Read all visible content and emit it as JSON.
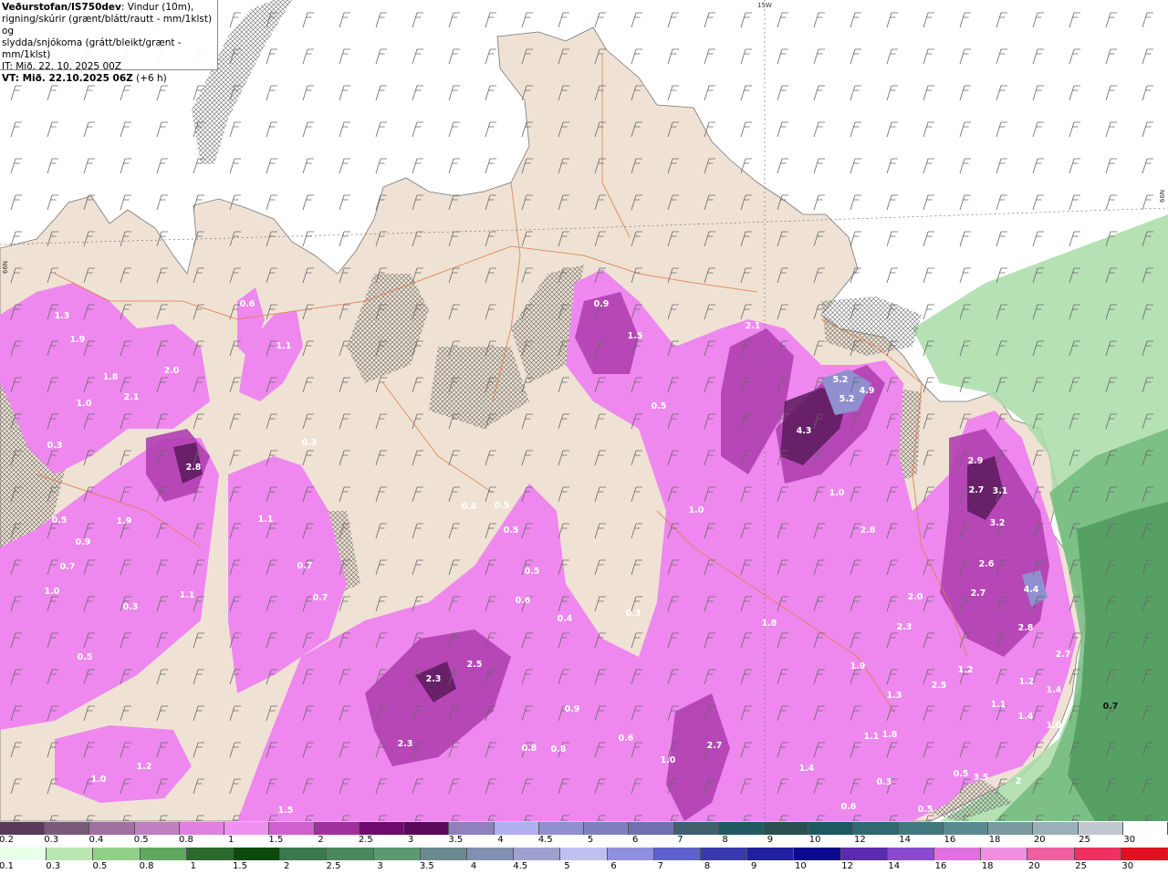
{
  "header": {
    "title_bold": "Veðurstofan/IS750dev",
    "title_rest": ": Vindur (10m),",
    "line2": "rigning/skúrir (grænt/blátt/rautt - mm/1klst) og",
    "line3": "slydda/snjókoma (grátt/bleikt/grænt - mm/1klst)",
    "line4": "IT: Mið. 22. 10. 2025 00Z",
    "line5_bold": "VT: Mið. 22.10.2025 06Z",
    "line5_rest": " (+6 h)"
  },
  "grid_labels": {
    "lon": "15W",
    "lat_right": "66N",
    "lat_left": "66N"
  },
  "colors": {
    "land": "#efe2d4",
    "sea": "#ffffff",
    "snow_light": "#ee88ee",
    "snow_mid": "#b040b0",
    "snow_dark": "#5a1a5a",
    "rain_light": "#a8dca8",
    "rain_mid": "#6fb87a",
    "rain_dark": "#3d8a4d",
    "road": "#e07a4a"
  },
  "map_labels": [
    {
      "text": "1.3"
    },
    {
      "text": "1.9"
    },
    {
      "text": "1.8"
    },
    {
      "text": "2.0"
    },
    {
      "text": "2.1"
    },
    {
      "text": "1.0"
    },
    {
      "text": "0.3"
    },
    {
      "text": "2.8"
    },
    {
      "text": "0.5"
    },
    {
      "text": "1.9"
    },
    {
      "text": "0.9"
    },
    {
      "text": "0.7"
    },
    {
      "text": "1.0"
    },
    {
      "text": "0.3"
    },
    {
      "text": "1.1"
    },
    {
      "text": "0.5"
    },
    {
      "text": "0.6"
    },
    {
      "text": "1.1"
    },
    {
      "text": "0.3"
    },
    {
      "text": "1.1"
    },
    {
      "text": "0.7"
    },
    {
      "text": "0.7"
    },
    {
      "text": "0.9"
    },
    {
      "text": "1.5"
    },
    {
      "text": "0.5"
    },
    {
      "text": "2.1"
    },
    {
      "text": "5.2"
    },
    {
      "text": "5.2"
    },
    {
      "text": "4.9"
    },
    {
      "text": "4.3"
    },
    {
      "text": "1.0"
    },
    {
      "text": "1.0"
    },
    {
      "text": "2.8"
    },
    {
      "text": "0.4"
    },
    {
      "text": "0.5"
    },
    {
      "text": "0.5"
    },
    {
      "text": "0.5"
    },
    {
      "text": "0.6"
    },
    {
      "text": "0.4"
    },
    {
      "text": "0.3"
    },
    {
      "text": "2.9"
    },
    {
      "text": "2.7"
    },
    {
      "text": "3.1"
    },
    {
      "text": "3.2"
    },
    {
      "text": "2.6"
    },
    {
      "text": "2.7"
    },
    {
      "text": "4.4"
    },
    {
      "text": "2.8"
    },
    {
      "text": "2.0"
    },
    {
      "text": "2.3"
    },
    {
      "text": "1.8"
    },
    {
      "text": "2.3"
    },
    {
      "text": "2.5"
    },
    {
      "text": "1.9"
    },
    {
      "text": "1.2"
    },
    {
      "text": "2.5"
    },
    {
      "text": "1.3"
    },
    {
      "text": "1.1"
    },
    {
      "text": "1.2"
    },
    {
      "text": "1.4"
    },
    {
      "text": "2.7"
    },
    {
      "text": "1.4"
    },
    {
      "text": "2.3"
    },
    {
      "text": "0.9"
    },
    {
      "text": "0.8"
    },
    {
      "text": "0.8"
    },
    {
      "text": "0.6"
    },
    {
      "text": "1.0"
    },
    {
      "text": "2.7"
    },
    {
      "text": "1.1"
    },
    {
      "text": "1.8"
    },
    {
      "text": "1.4"
    },
    {
      "text": "0.5"
    },
    {
      "text": "1.0"
    },
    {
      "text": "1.2"
    },
    {
      "text": "1.5"
    },
    {
      "text": "0.5"
    },
    {
      "text": "0.7"
    },
    {
      "text": "1.0"
    },
    {
      "text": "2"
    },
    {
      "text": "3.5"
    },
    {
      "text": "0.3"
    },
    {
      "text": "0.6"
    },
    {
      "text": "2.7"
    },
    {
      "text": "0.5"
    }
  ],
  "colorbar_snow": {
    "labels": [
      "0.2",
      "0.3",
      "0.4",
      "0.5",
      "0.8",
      "1",
      "1.5",
      "2",
      "2.5",
      "3",
      "3.5",
      "4",
      "4.5",
      "5",
      "6",
      "7",
      "8",
      "9",
      "10",
      "12",
      "14",
      "16",
      "18",
      "20",
      "25",
      "30"
    ],
    "colors": [
      "#5a3a5a",
      "#7a5a7a",
      "#a070a0",
      "#c080c0",
      "#e080e0",
      "#f090f0",
      "#d060d0",
      "#a030a0",
      "#700a70",
      "#5a0a5a",
      "#9080c0",
      "#b0b0f0",
      "#9090d0",
      "#8080c0",
      "#7070b0",
      "#406070",
      "#205a60",
      "#2a5050",
      "#1a5a60",
      "#306a70",
      "#407a80",
      "#5a8a90",
      "#7a9aa0",
      "#9ab0b8",
      "#c0c8d0",
      "#ffffff"
    ]
  },
  "colorbar_rain": {
    "labels": [
      "0.1",
      "0.3",
      "0.5",
      "0.8",
      "1",
      "1.5",
      "2",
      "2.5",
      "3",
      "3.5",
      "4",
      "4.5",
      "5",
      "6",
      "7",
      "8",
      "9",
      "10",
      "12",
      "14",
      "16",
      "18",
      "20",
      "25",
      "30"
    ],
    "colors": [
      "#e8ffe8",
      "#b8e8b0",
      "#90d088",
      "#60a860",
      "#2a6a2a",
      "#0a4a0a",
      "#3a7a4a",
      "#4a8a5a",
      "#5a9a70",
      "#6a8a90",
      "#8090b0",
      "#a0a0d0",
      "#c0c0f0",
      "#9090e0",
      "#6060d0",
      "#3a3ab0",
      "#2020a0",
      "#0a0a90",
      "#5a2ab0",
      "#8a4ad0",
      "#e070e0",
      "#f090e0",
      "#f060a0",
      "#f03060",
      "#e01020"
    ]
  }
}
